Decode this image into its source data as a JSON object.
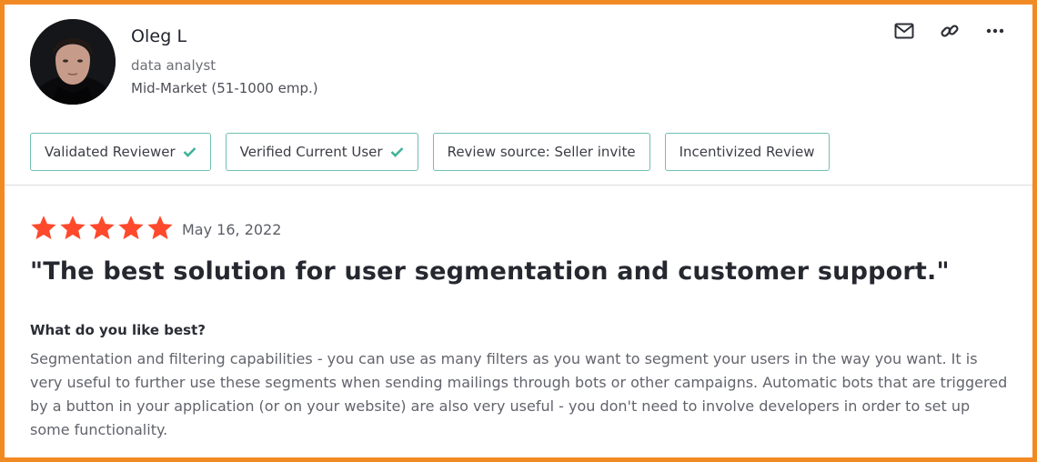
{
  "reviewer": {
    "name": "Oleg L",
    "title": "data analyst",
    "segment": "Mid-Market (51-1000 emp.)"
  },
  "actions": [
    {
      "icon": "mail-icon"
    },
    {
      "icon": "link-icon"
    },
    {
      "icon": "more-options-icon"
    }
  ],
  "badges": [
    {
      "label": "Validated Reviewer",
      "checked": true
    },
    {
      "label": "Verified Current User",
      "checked": true
    },
    {
      "label": "Review source: Seller invite",
      "checked": false
    },
    {
      "label": "Incentivized Review",
      "checked": false
    }
  ],
  "review": {
    "rating": 5,
    "max_rating": 5,
    "date": "May 16, 2022",
    "headline": "\"The best solution for user segmentation and customer support.\"",
    "question": "What do you like best?",
    "answer": "Segmentation and filtering capabilities - you can use as many filters as you want to segment your users in the way you want. It is very useful to further use these segments when sending mailings through bots or other campaigns. Automatic bots that are triggered by a button in your application (or on your website) are also very useful - you don't need to involve developers in order to set up some functionality."
  },
  "colors": {
    "frame_border": "#f28a24",
    "star": "#ff492c",
    "badge_border": "#6fbfb3",
    "check": "#3fb39a"
  }
}
